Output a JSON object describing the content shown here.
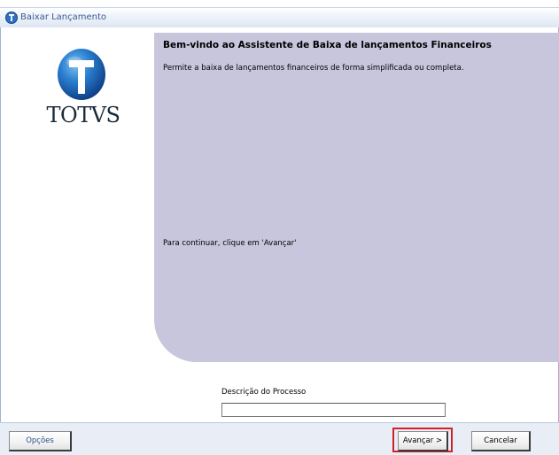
{
  "window": {
    "title": "Baixar Lançamento"
  },
  "logo": {
    "brand_text": "TOTVS",
    "icon": "totvs-globe-icon",
    "colors": {
      "globe": "#1f6fc0",
      "text": "#1a2a3a"
    }
  },
  "wizard": {
    "title": "Bem-vindo ao Assistente de Baixa de lançamentos Financeiros",
    "description": "Permite a baixa de lançamentos financeiros de forma simplificada ou completa.",
    "continue_hint": "Para continuar, clique em 'Avançar'",
    "panel_color": "#c8c6dc"
  },
  "process": {
    "label": "Descrição do Processo",
    "value": ""
  },
  "footer": {
    "options_label": "Opções",
    "next_label": "Avançar >",
    "cancel_label": "Cancelar",
    "highlight_color": "#d0202a"
  }
}
